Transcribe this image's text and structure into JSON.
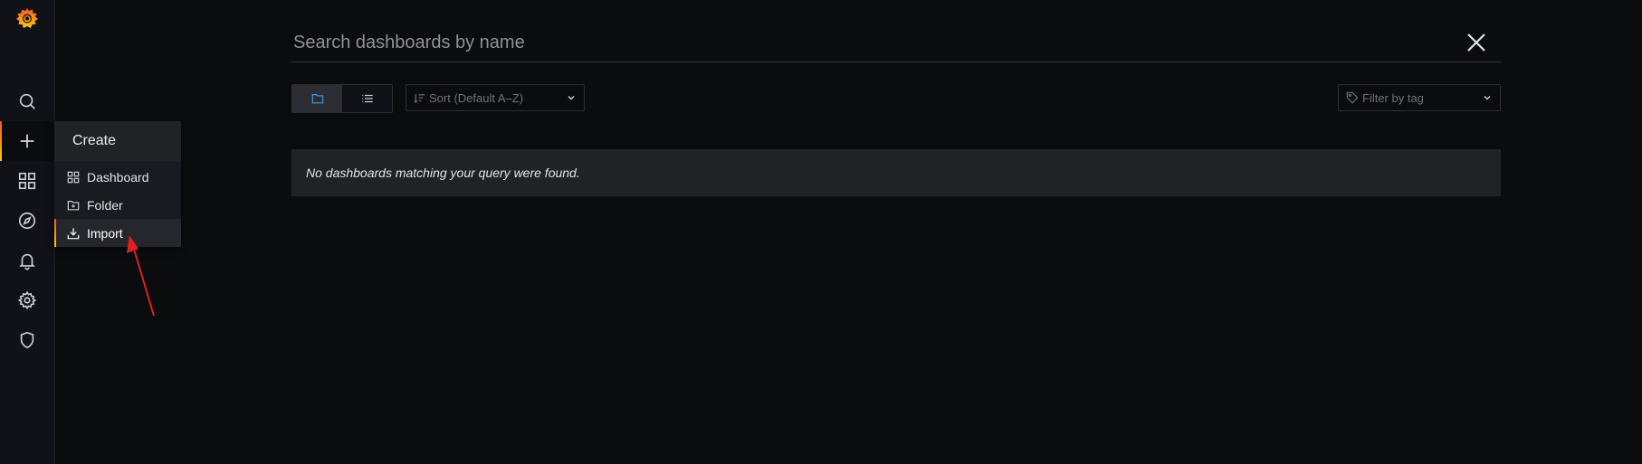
{
  "sidebar": {
    "logo": "grafana-logo",
    "items": [
      {
        "icon": "search-icon",
        "active": false
      },
      {
        "icon": "plus-icon",
        "active": true
      },
      {
        "icon": "dashboards-icon",
        "active": false
      },
      {
        "icon": "compass-icon",
        "active": false
      },
      {
        "icon": "bell-icon",
        "active": false
      },
      {
        "icon": "gear-icon",
        "active": false
      },
      {
        "icon": "shield-icon",
        "active": false
      }
    ]
  },
  "create_menu": {
    "title": "Create",
    "items": [
      {
        "label": "Dashboard",
        "icon": "apps-icon"
      },
      {
        "label": "Folder",
        "icon": "folder-plus-icon"
      },
      {
        "label": "Import",
        "icon": "import-icon",
        "active": true
      }
    ]
  },
  "search": {
    "placeholder": "Search dashboards by name",
    "value": ""
  },
  "toolbar": {
    "view_modes": [
      {
        "icon": "folder-view-icon",
        "active": true
      },
      {
        "icon": "list-view-icon",
        "active": false
      }
    ],
    "sort_label": "Sort (Default A–Z)",
    "tag_filter_placeholder": "Filter by tag"
  },
  "results": {
    "empty_message": "No dashboards matching your query were found."
  },
  "colors": {
    "background": "#0b0c0e",
    "sidebar": "#111217",
    "accent_gradient": [
      "#f05a28",
      "#fbca0a"
    ],
    "active_blue": "#33a2e5",
    "annotation_red": "#e02020"
  }
}
